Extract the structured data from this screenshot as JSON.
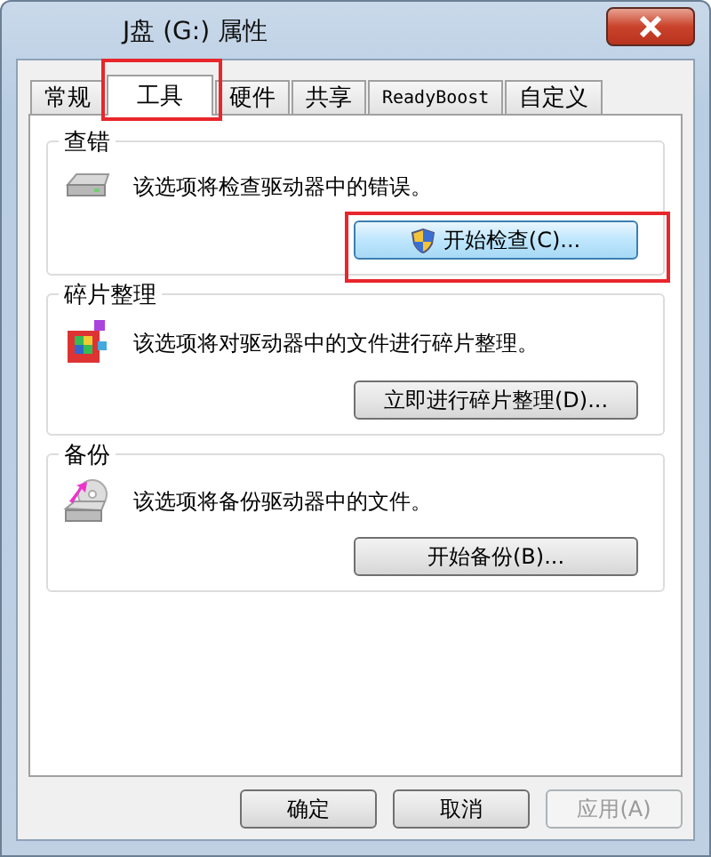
{
  "window": {
    "title": "J盘 (G:) 属性"
  },
  "tabs": [
    {
      "label": "常规",
      "selected": false,
      "highlighted": false
    },
    {
      "label": "工具",
      "selected": true,
      "highlighted": true
    },
    {
      "label": "硬件",
      "selected": false,
      "highlighted": false
    },
    {
      "label": "共享",
      "selected": false,
      "highlighted": false
    },
    {
      "label": "ReadyBoost",
      "selected": false,
      "highlighted": false,
      "kind": "mono"
    },
    {
      "label": "自定义",
      "selected": false,
      "highlighted": false
    }
  ],
  "sections": [
    {
      "title": "查错",
      "kind": "check",
      "description": "该选项将检查驱动器中的错误。",
      "button": {
        "label": "开始检查(C)...",
        "shield": true,
        "highlighted": true,
        "focused": true
      }
    },
    {
      "title": "碎片整理",
      "kind": "defrag",
      "description": "该选项将对驱动器中的文件进行碎片整理。",
      "button": {
        "label": "立即进行碎片整理(D)...",
        "shield": false,
        "highlighted": false,
        "focused": false
      }
    },
    {
      "title": "备份",
      "kind": "backup",
      "description": "该选项将备份驱动器中的文件。",
      "button": {
        "label": "开始备份(B)...",
        "shield": false,
        "highlighted": false,
        "focused": false
      }
    }
  ],
  "buttons": [
    {
      "label": "确定",
      "disabled": false
    },
    {
      "label": "取消",
      "disabled": false
    },
    {
      "label": "应用(A)",
      "disabled": true
    }
  ]
}
